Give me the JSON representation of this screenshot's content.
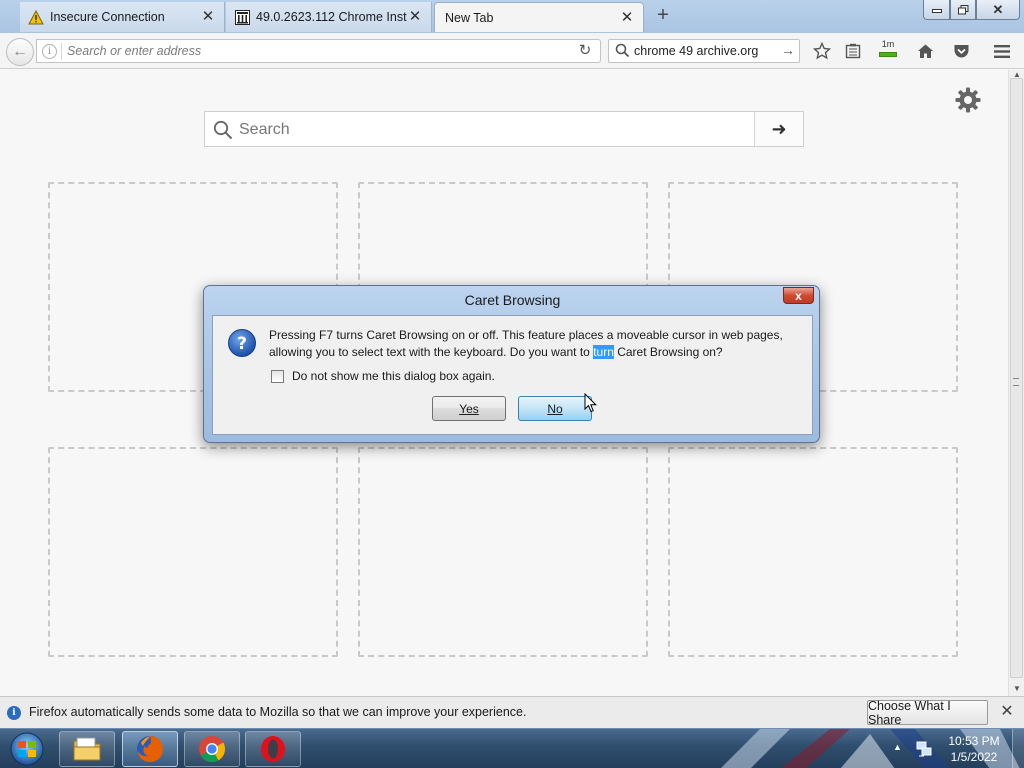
{
  "browser": {
    "tabs": [
      {
        "title": "Insecure Connection",
        "icon": "warning-icon",
        "active": false
      },
      {
        "title": "49.0.2623.112 Chrome Inst...",
        "icon": "archive-icon",
        "active": false
      },
      {
        "title": "New Tab",
        "icon": "none",
        "active": true
      }
    ],
    "address_placeholder": "Search or enter address",
    "search_engine_query": "chrome 49 archive.org",
    "toolbar_icons": [
      "bookmark-star-icon",
      "reading-list-icon",
      "download-icon",
      "home-icon",
      "pocket-icon",
      "menu-icon"
    ],
    "download_badge": "1m"
  },
  "newtab": {
    "search_placeholder": "Search",
    "tiles_count_rows": 2
  },
  "dialog": {
    "title": "Caret Browsing",
    "message_before": "Pressing F7 turns Caret Browsing on or off. This feature places a moveable cursor in web pages, allowing you to select text with the keyboard. Do you want to ",
    "message_highlight": "turn",
    "message_after": " Caret Browsing on?",
    "checkbox_label": "Do not show me this dialog box again.",
    "checkbox_checked": false,
    "yes_label": "Yes",
    "no_label": "No",
    "close_label": "x"
  },
  "notification": {
    "text": "Firefox automatically sends some data to Mozilla so that we can improve your experience.",
    "button_label": "Choose What I Share"
  },
  "taskbar": {
    "apps": [
      "file-explorer-icon",
      "firefox-icon",
      "chrome-icon",
      "opera-icon"
    ],
    "time": "10:53 PM",
    "date": "1/5/2022"
  },
  "colors": {
    "selection_highlight": "#3399ff",
    "dialog_frame": "#a6c2e4",
    "close_button_red": "#c23b23"
  }
}
